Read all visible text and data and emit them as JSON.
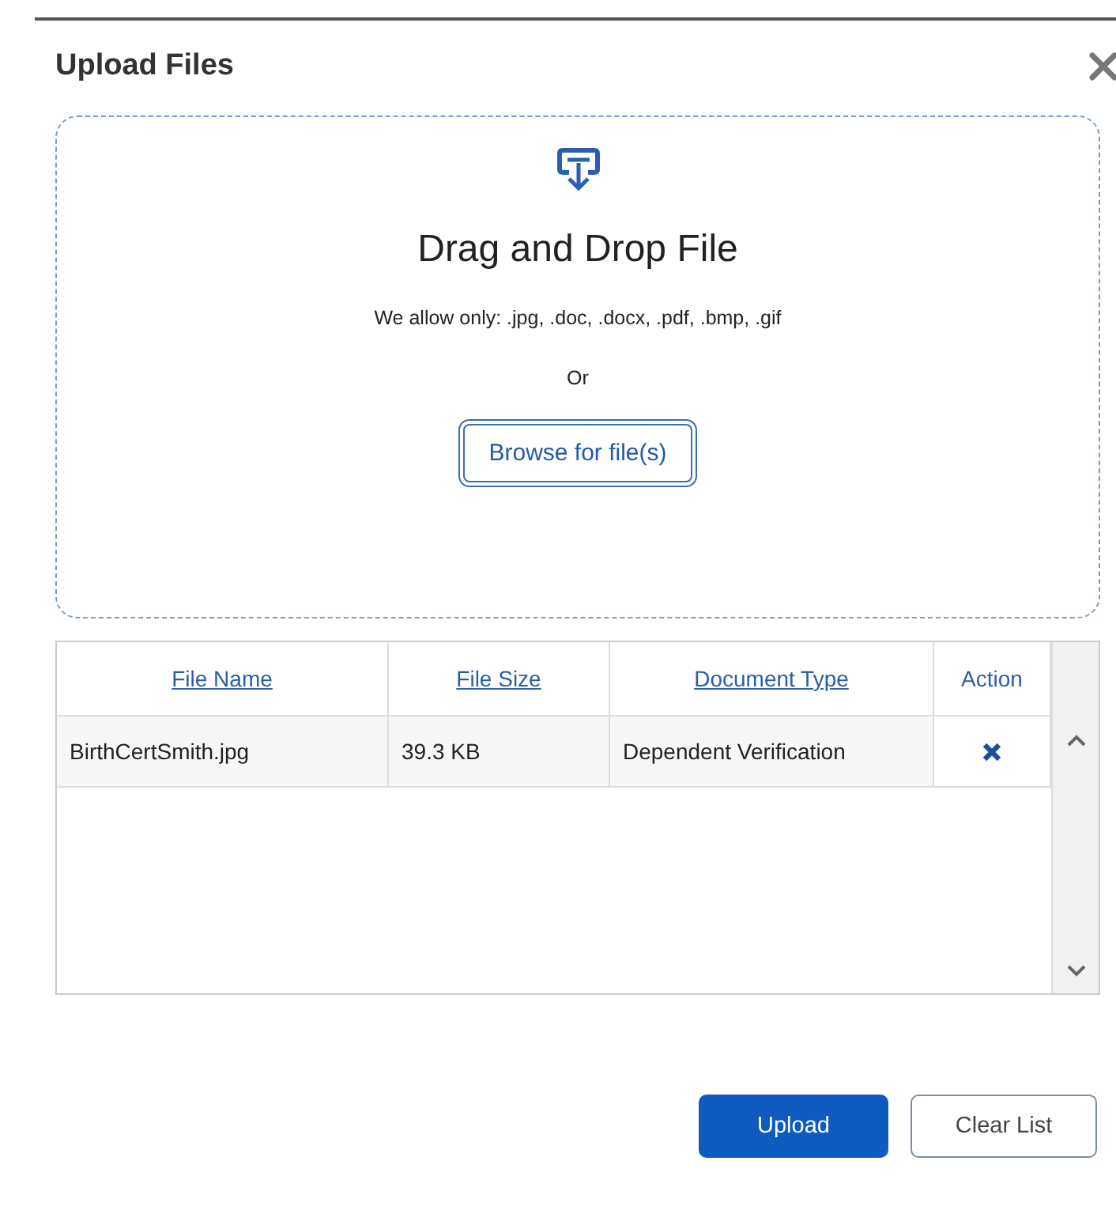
{
  "dialog": {
    "title": "Upload Files"
  },
  "dropzone": {
    "heading": "Drag and Drop File",
    "allowed": "We allow only: .jpg, .doc, .docx, .pdf, .bmp, .gif",
    "separator": "Or",
    "browse_button": "Browse for file(s)"
  },
  "table": {
    "columns": [
      {
        "label": "File Name",
        "sortable": true
      },
      {
        "label": "File Size",
        "sortable": true
      },
      {
        "label": "Document Type",
        "sortable": true
      },
      {
        "label": "Action",
        "sortable": false
      }
    ],
    "rows": [
      {
        "file_name": "BirthCertSmith.jpg",
        "file_size": "39.3 KB",
        "document_type": "Dependent Verification"
      }
    ]
  },
  "buttons": [
    {
      "label": "Upload",
      "kind": "primary"
    },
    {
      "label": "Clear List",
      "kind": "secondary"
    }
  ]
}
